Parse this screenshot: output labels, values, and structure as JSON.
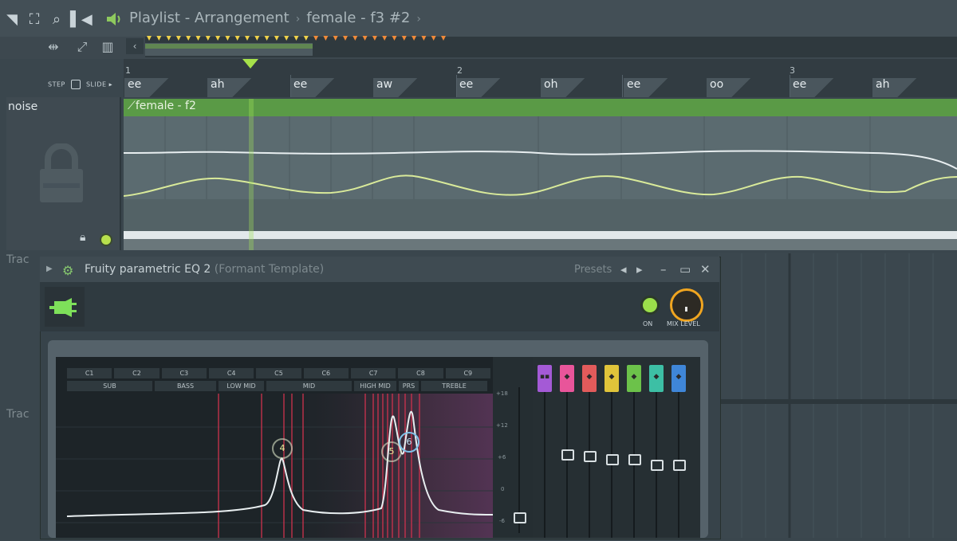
{
  "topbar": {
    "breadcrumb": [
      "Playlist - Arrangement",
      "female - f3 #2"
    ]
  },
  "toolbar": {
    "step_label": "STEP",
    "slide_label": "SLIDE"
  },
  "timeline": {
    "bars": [
      "1",
      "2",
      "3"
    ],
    "notes": [
      "ee",
      "ah",
      "ee",
      "aw",
      "ee",
      "oh",
      "ee",
      "oo",
      "ee",
      "ah"
    ]
  },
  "track": {
    "name": "noise",
    "other_tracks": [
      "Trac",
      "Trac"
    ]
  },
  "clip": {
    "title": "female - f2"
  },
  "eq": {
    "title": "Fruity parametric EQ 2",
    "subtitle": "(Formant Template)",
    "presets_label": "Presets",
    "on_label": "ON",
    "mix_label": "MIX LEVEL",
    "notes_row": [
      "C1",
      "C2",
      "C3",
      "C4",
      "C5",
      "C6",
      "C7",
      "C8",
      "C9"
    ],
    "ranges_row": [
      "SUB",
      "BASS",
      "LOW MID",
      "MID",
      "HIGH MID",
      "PRS",
      "TREBLE"
    ],
    "db_labels": [
      "+18",
      "+12",
      "+6",
      "0",
      "-6"
    ],
    "node_labels": [
      "4",
      "5",
      "6"
    ],
    "band_colors": [
      "#a45ad6",
      "#e8559a",
      "#e25b5b",
      "#e0c43a",
      "#6cc24a",
      "#3dbfa5",
      "#3f86d8"
    ],
    "band_positions": [
      0.62,
      0.55,
      0.57,
      0.6,
      0.6,
      0.65,
      0.65
    ]
  }
}
